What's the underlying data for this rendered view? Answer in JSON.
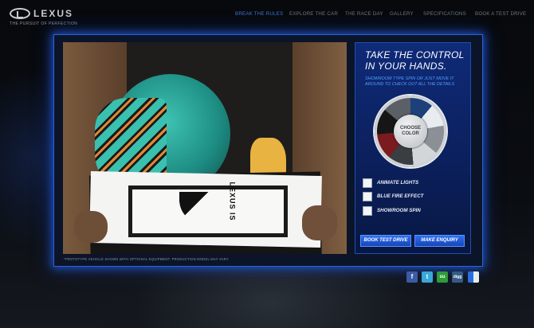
{
  "brand": {
    "name": "LEXUS",
    "tagline": "THE PURSUIT OF PERFECTION"
  },
  "nav": {
    "items": [
      {
        "label": "BREAK THE RULES",
        "active": true
      },
      {
        "label": "EXPLORE THE CAR",
        "active": false
      },
      {
        "label": "THE RACE DAY",
        "active": false
      },
      {
        "label": "GALLERY",
        "active": false
      },
      {
        "label": "SPECIFICATIONS",
        "active": false
      },
      {
        "label": "BOOK A TEST DRIVE",
        "active": false
      }
    ]
  },
  "stage": {
    "marker_text": "LEXUS IS",
    "disclaimer": "*PROTOTYPE VEHICLE SHOWN WITH OPTIONAL EQUIPMENT. PRODUCTION MODEL MAY VARY."
  },
  "panel": {
    "title": "TAKE THE CONTROL IN YOUR HANDS.",
    "subtitle": "SHOWROOM TYPE SPIN OR JUST MOVE IT AROUND TO CHECK OUT ALL THE DETAILS",
    "color_wheel_label": "CHOOSE COLOR",
    "options": [
      {
        "label": "ANIMATE LIGHTS",
        "checked": false
      },
      {
        "label": "BLUE FIRE EFFECT",
        "checked": false
      },
      {
        "label": "SHOWROOM SPIN",
        "checked": false
      }
    ],
    "buttons": {
      "test_drive": "BOOK TEST DRIVE",
      "enquiry": "MAKE ENQUIRY"
    }
  },
  "social": [
    {
      "icon": "facebook-icon",
      "glyph": "f",
      "color": "#3b5ba3"
    },
    {
      "icon": "twitter-icon",
      "glyph": "t",
      "color": "#3aa7d8"
    },
    {
      "icon": "stumbleupon-icon",
      "glyph": "su",
      "color": "#2d9b3a"
    },
    {
      "icon": "digg-icon",
      "glyph": "digg",
      "color": "#355a86"
    },
    {
      "icon": "delicious-icon",
      "glyph": "",
      "color": "#d9dde2"
    }
  ],
  "colors": {
    "accent": "#2b63d8",
    "panel": "#0f2a78",
    "nav_active": "#3a78d6"
  }
}
